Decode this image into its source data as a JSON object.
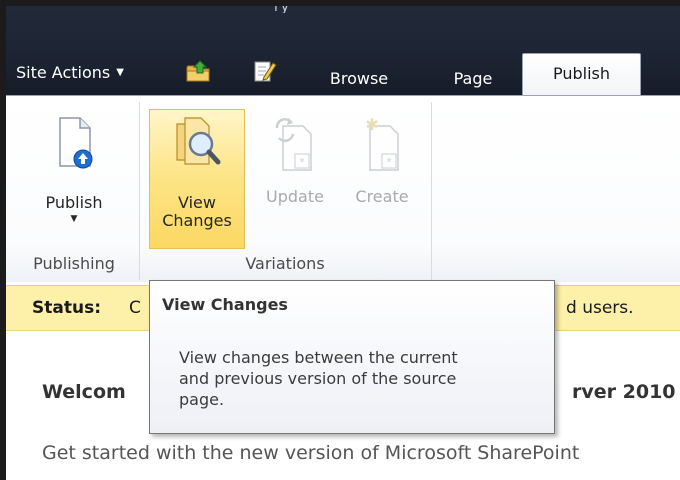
{
  "header": {
    "title_fragment": "ry",
    "site_actions_label": "Site Actions",
    "quick_access_icons": [
      "up-folder-icon",
      "edit-page-icon"
    ]
  },
  "tabs": [
    {
      "label": "Browse",
      "active": false
    },
    {
      "label": "Page",
      "active": false
    },
    {
      "label": "Publish",
      "active": true
    }
  ],
  "ribbon": {
    "groups": [
      {
        "label": "Publishing",
        "buttons": [
          {
            "label": "Publish",
            "has_dropdown": true,
            "icon": "publish-icon",
            "enabled": true
          }
        ]
      },
      {
        "label": "Variations",
        "buttons": [
          {
            "label_line1": "View",
            "label_line2": "Changes",
            "icon": "view-changes-icon",
            "enabled": true,
            "hovered": true
          },
          {
            "label": "Update",
            "icon": "update-icon",
            "enabled": false
          },
          {
            "label": "Create",
            "icon": "create-icon",
            "enabled": false
          }
        ]
      }
    ]
  },
  "status_bar": {
    "label": "Status:",
    "text_left_fragment": "C",
    "text_right_fragment": "d users."
  },
  "content": {
    "welcome_left": "Welcom",
    "welcome_right": "rver 2010",
    "get_started": "Get started with the new version of Microsoft SharePoint"
  },
  "tooltip": {
    "title": "View Changes",
    "line1": "View changes between the current",
    "line2": "and previous version of the source",
    "line3": "page."
  },
  "colors": {
    "topbar": "#1d2433",
    "status_bg": "#fdf0a8",
    "hover_button": "#fcd862",
    "tab_active_bg": "#ffffff"
  }
}
